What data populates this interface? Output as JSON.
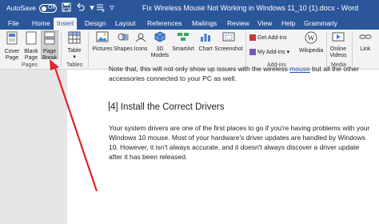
{
  "titlebar": {
    "autosave_label": "AutoSave",
    "autosave_state": "Off",
    "doc_title": "Fix Wireless Mouse Not Working in Windows 11_10 (1).docx  -  Word"
  },
  "tabs": [
    "File",
    "Home",
    "Insert",
    "Design",
    "Layout",
    "References",
    "Mailings",
    "Review",
    "View",
    "Help",
    "Grammarly"
  ],
  "ribbon": {
    "pages": {
      "cover_page": "Cover\nPage",
      "blank_page": "Blank\nPage",
      "page_break": "Page\nBreak",
      "label": "Pages"
    },
    "tables": {
      "table": "Table",
      "label": "Tables"
    },
    "illustrations": {
      "pictures": "Pictures",
      "shapes": "Shapes",
      "icons": "Icons",
      "models": "3D\nModels",
      "smartart": "SmartArt",
      "chart": "Chart",
      "screenshot": "Screenshot"
    },
    "addins": {
      "get": "Get Add-ins",
      "my": "My Add-ins",
      "label": "Add-ins"
    },
    "media": {
      "wikipedia": "Wikipedia",
      "online_videos": "Online\nVideos",
      "label": "Media"
    },
    "links": {
      "link": "Link"
    }
  },
  "document": {
    "para1_a": "Note that, this will not only show up issues with the wireless ",
    "para1_link": "mouse",
    "para1_b": " but all the other accessories connected to your PC as well.",
    "heading": "4] Install the Correct Drivers",
    "para2": "Your system drivers are one of the first places to go if you're having problems with your Windows 10 mouse. Most of your hardware's driver updates are handled by Windows 10. However, it isn't always accurate, and it doesn't always discover a driver update after it has been released."
  },
  "colors": {
    "titlebar_blue": "#2b579a",
    "arrow_red": "#e0232b"
  }
}
